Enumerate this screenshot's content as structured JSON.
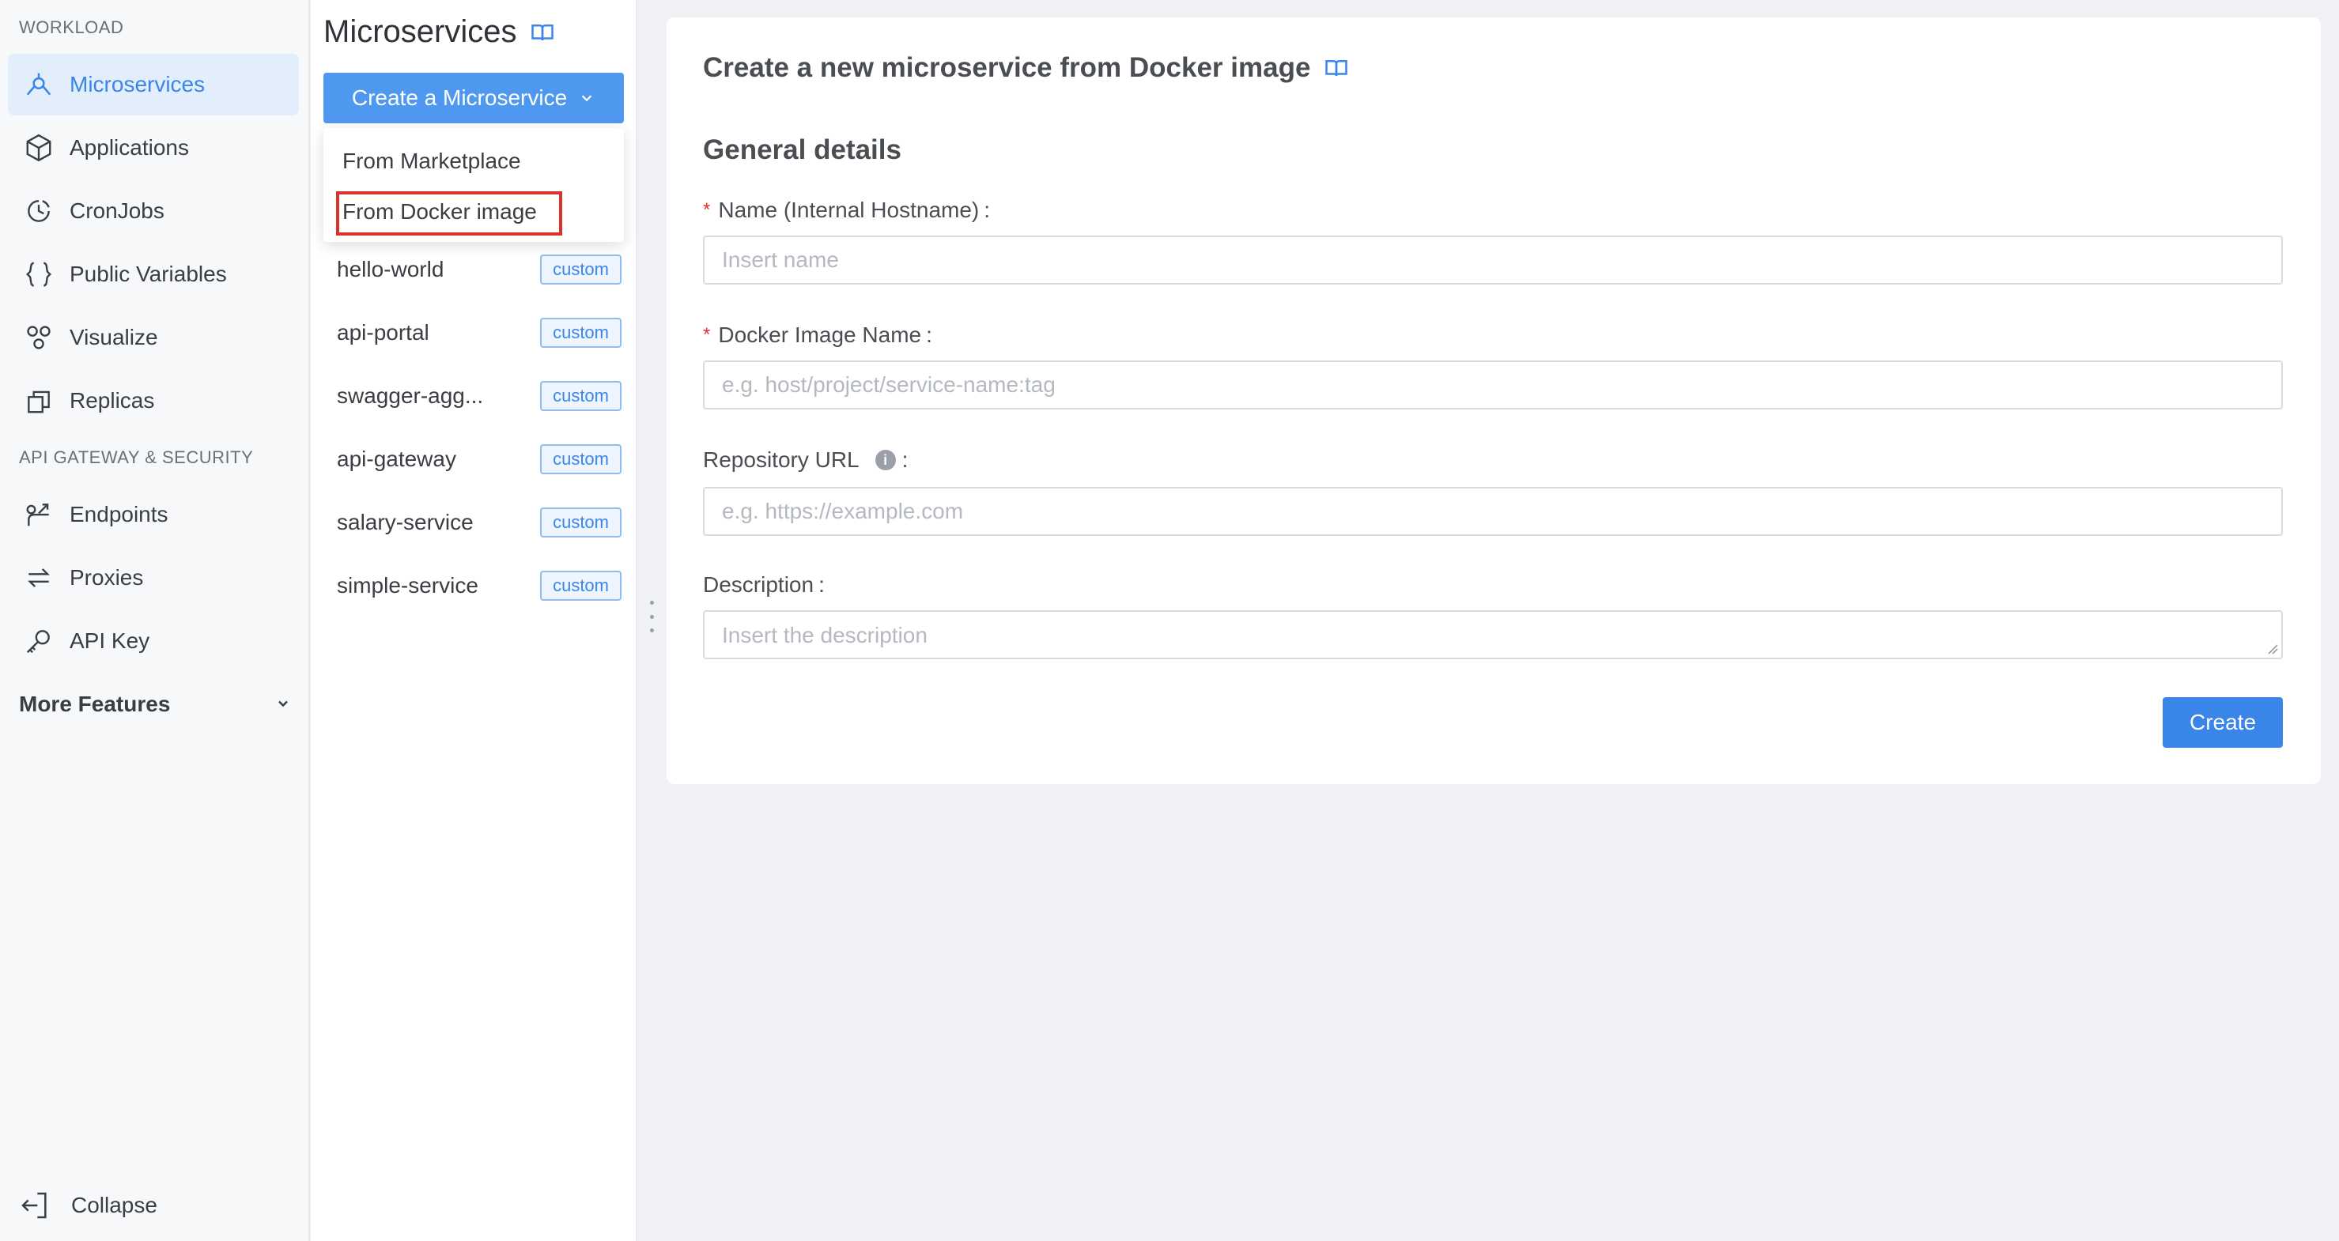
{
  "nav": {
    "workload_title": "WORKLOAD",
    "items": [
      {
        "label": "Microservices",
        "icon": "microservices-icon",
        "active": true
      },
      {
        "label": "Applications",
        "icon": "cube-icon"
      },
      {
        "label": "CronJobs",
        "icon": "clock-icon"
      },
      {
        "label": "Public Variables",
        "icon": "braces-icon"
      },
      {
        "label": "Visualize",
        "icon": "graph-icon"
      },
      {
        "label": "Replicas",
        "icon": "copy-icon"
      }
    ],
    "gateway_title": "API GATEWAY & SECURITY",
    "gateway_items": [
      {
        "label": "Endpoints",
        "icon": "endpoint-icon"
      },
      {
        "label": "Proxies",
        "icon": "swap-icon"
      },
      {
        "label": "API Key",
        "icon": "key-icon"
      }
    ],
    "more_features": "More Features",
    "collapse": "Collapse"
  },
  "list": {
    "title": "Microservices",
    "create_button": "Create a Microservice",
    "dropdown": {
      "from_marketplace": "From Marketplace",
      "from_docker": "From Docker image"
    },
    "items": [
      {
        "name": "hello-world",
        "tag": "custom"
      },
      {
        "name": "api-portal",
        "tag": "custom"
      },
      {
        "name": "swagger-agg...",
        "tag": "custom"
      },
      {
        "name": "api-gateway",
        "tag": "custom"
      },
      {
        "name": "salary-service",
        "tag": "custom"
      },
      {
        "name": "simple-service",
        "tag": "custom"
      }
    ]
  },
  "form": {
    "title": "Create a new microservice from Docker image",
    "section": "General details",
    "name_label": "Name (Internal Hostname)",
    "name_placeholder": "Insert name",
    "image_label": "Docker Image Name",
    "image_placeholder": "e.g. host/project/service-name:tag",
    "repo_label": "Repository URL",
    "repo_placeholder": "e.g. https://example.com",
    "desc_label": "Description",
    "desc_placeholder": "Insert the description",
    "required_mark": "*",
    "info_mark": "i",
    "colon": ":",
    "submit": "Create"
  },
  "colors": {
    "accent": "#3a86e8",
    "button": "#4f98ef",
    "active_bg": "#e3eefc",
    "highlight_border": "#d9342b",
    "required": "#e0322a"
  }
}
